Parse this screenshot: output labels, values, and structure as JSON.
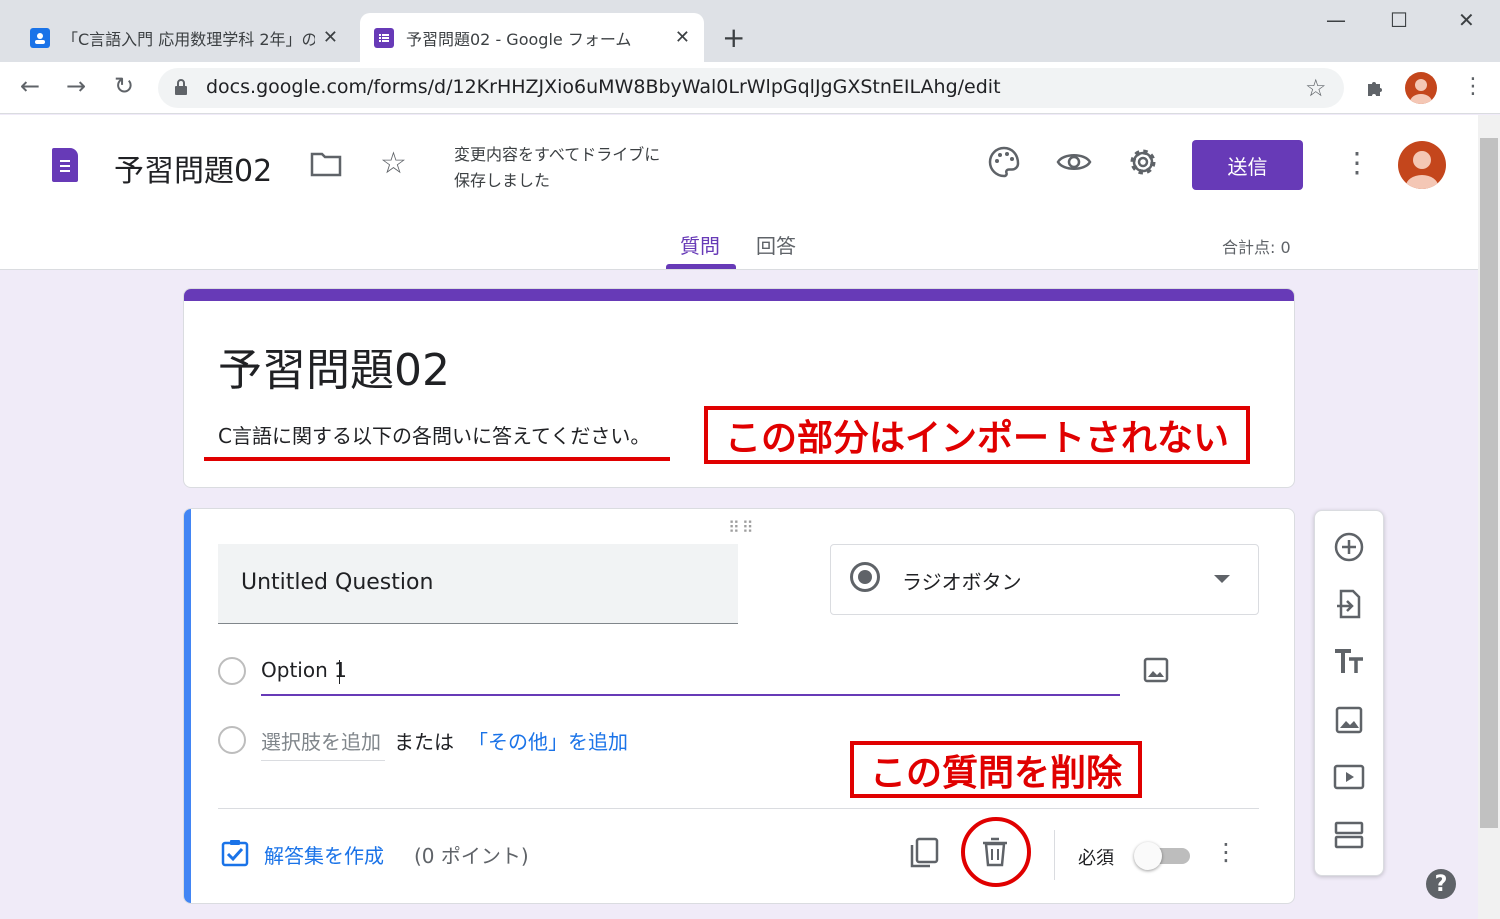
{
  "browser": {
    "tabs": [
      {
        "title": "「C言語入門 応用数理学科 2年」の",
        "favicon_color": "#1a73e8",
        "active": false
      },
      {
        "title": "予習問題02 - Google フォーム",
        "favicon_color": "#673ab7",
        "active": true
      }
    ],
    "new_tab": "+",
    "window_controls": {
      "minimize": "—",
      "maximize": "☐",
      "close": "✕"
    },
    "nav": {
      "back": "←",
      "forward": "→",
      "reload": "↻"
    },
    "url": "docs.google.com/forms/d/12KrHHZJXio6uMW8BbyWal0LrWlpGqlJgGXStnEILAhg/edit"
  },
  "header": {
    "form_title": "予習問題02",
    "save_status_line1": "変更内容をすべてドライブに",
    "save_status_line2": "保存しました",
    "send_label": "送信",
    "tabs": [
      {
        "label": "質問",
        "active": true
      },
      {
        "label": "回答",
        "active": false
      }
    ],
    "total_points": "合計点: 0",
    "accent_color": "#673ab7"
  },
  "title_card": {
    "title": "予習問題02",
    "description": "C言語に関する以下の各問いに答えてください。"
  },
  "annotations": {
    "not_imported": "この部分はインポートされない",
    "delete_question": "この質問を削除"
  },
  "question": {
    "title": "Untitled Question",
    "type_label": "ラジオボタン",
    "option1": "Option 1",
    "add_option": "選択肢を追加",
    "or": "または",
    "add_other": "「その他」を追加",
    "answer_key": "解答集を作成",
    "points": "(0 ポイント)",
    "required_label": "必須",
    "required": false
  },
  "side_toolbar": [
    "add-question-icon",
    "import-questions-icon",
    "title-text-icon",
    "add-image-icon",
    "add-video-icon",
    "add-section-icon"
  ],
  "help": "?"
}
